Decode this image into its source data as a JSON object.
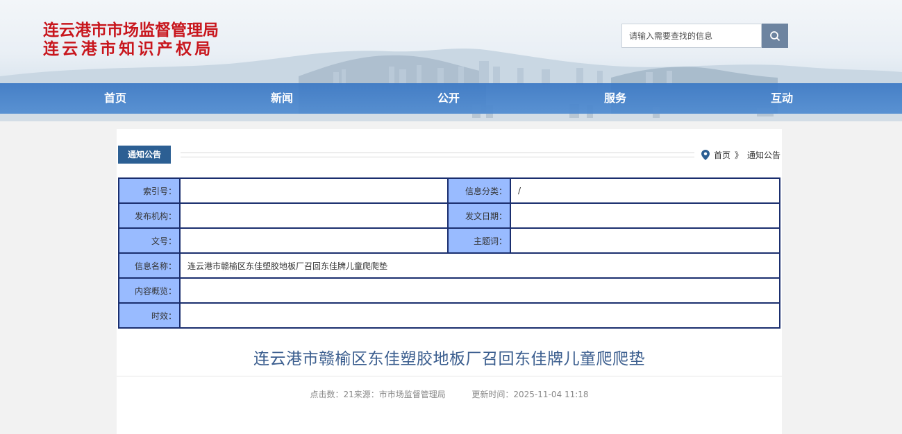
{
  "header": {
    "title_line1": "连云港市市场监督管理局",
    "title_line2": "连云港市知识产权局",
    "search_placeholder": "请输入需要查找的信息",
    "search_icon": "search-icon"
  },
  "nav": {
    "items": [
      {
        "label": "首页"
      },
      {
        "label": "新闻"
      },
      {
        "label": "公开"
      },
      {
        "label": "服务"
      },
      {
        "label": "互动"
      }
    ]
  },
  "section": {
    "tag": "通知公告",
    "breadcrumb": {
      "icon": "location-pin-icon",
      "home": "首页",
      "separator": "》",
      "current": "通知公告"
    }
  },
  "meta_table": {
    "index_label": "索引号：",
    "index_value": "",
    "category_label": "信息分类：",
    "category_value": "/",
    "publisher_label": "发布机构：",
    "publisher_value": "",
    "date_label": "发文日期：",
    "date_value": "",
    "docno_label": "文号：",
    "docno_value": "",
    "keywords_label": "主题词：",
    "keywords_value": "",
    "name_label": "信息名称：",
    "name_value": "连云港市赣榆区东佳塑胶地板厂召回东佳牌儿童爬爬垫",
    "summary_label": "内容概览：",
    "summary_value": "",
    "validity_label": "时效：",
    "validity_value": ""
  },
  "article": {
    "title": "连云港市赣榆区东佳塑胶地板厂召回东佳牌儿童爬爬垫",
    "info_left": "点击数：21来源：市市场监督管理局",
    "info_right": "更新时间：2025-11-04 11:18"
  },
  "colors": {
    "title_red": "#c8161d",
    "nav_blue": "#3b78c4",
    "tag_blue": "#2c5f93",
    "label_bg": "#99bbff",
    "table_border": "#1a2e6e",
    "article_title": "#3a5d8e"
  }
}
